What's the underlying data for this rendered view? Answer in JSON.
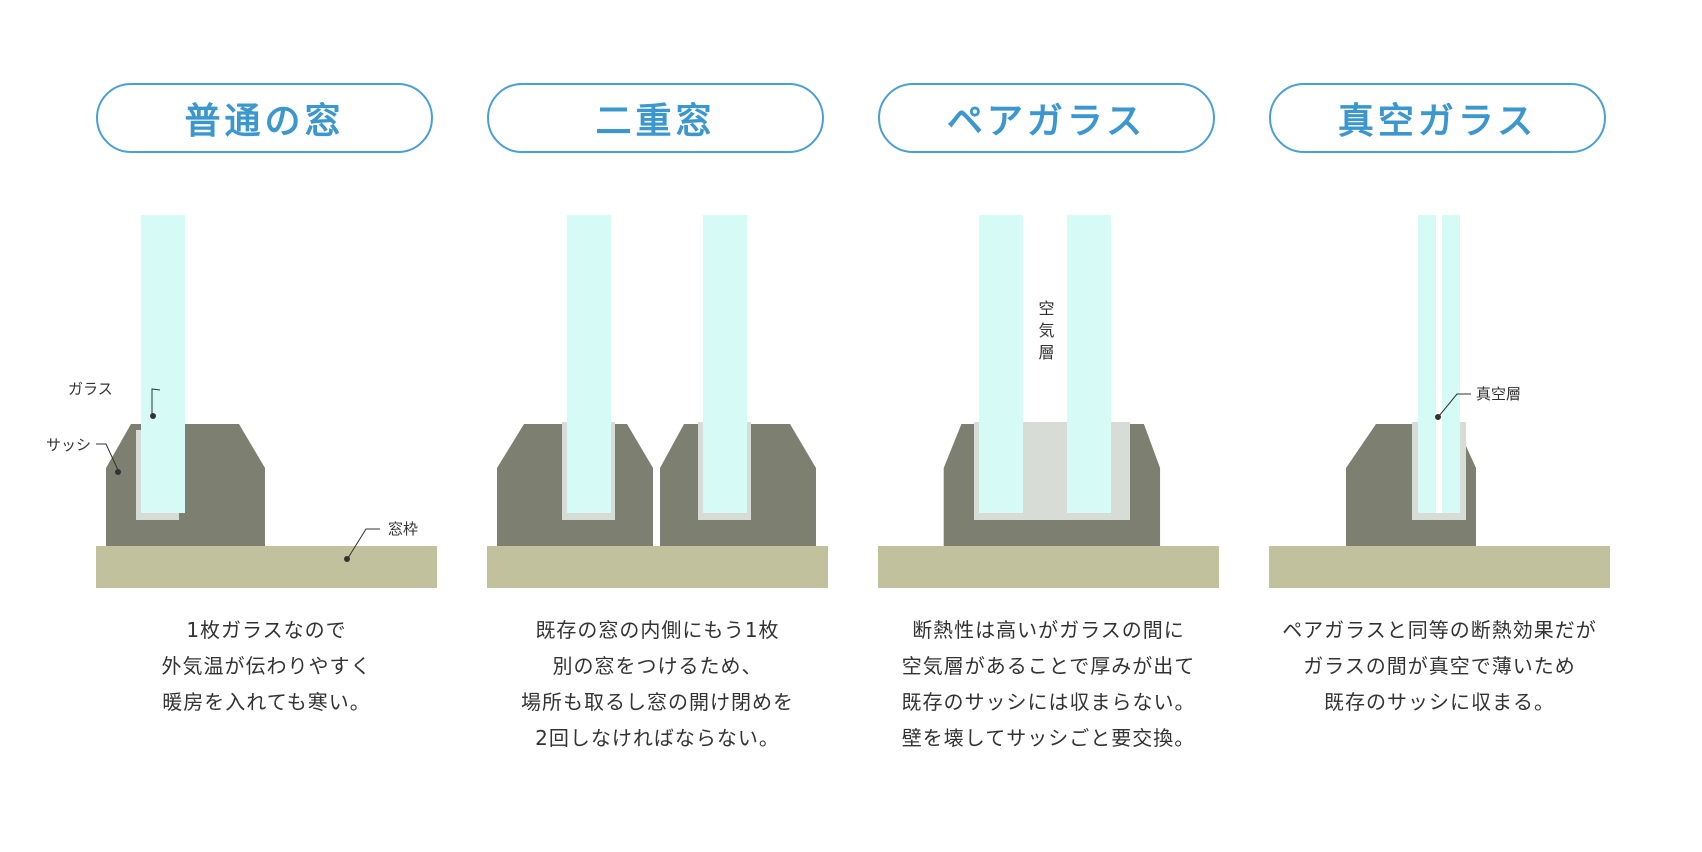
{
  "panels": [
    {
      "title": "普通の窓",
      "labels": {
        "glass": "ガラス",
        "sash": "サッシ",
        "frame": "窓枠"
      },
      "caption": [
        "1枚ガラスなので",
        "外気温が伝わりやすく",
        "暖房を入れても寒い。"
      ]
    },
    {
      "title": "二重窓",
      "caption": [
        "既存の窓の内側にもう1枚",
        "別の窓をつけるため、",
        "場所も取るし窓の開け閉めを",
        "2回しなければならない。"
      ]
    },
    {
      "title": "ペアガラス",
      "labels": {
        "air_layer": "空気層"
      },
      "caption": [
        "断熱性は高いがガラスの間に",
        "空気層があることで厚みが出て",
        "既存のサッシには収まらない。",
        "壁を壊してサッシごと要交換。"
      ]
    },
    {
      "title": "真空ガラス",
      "labels": {
        "vacuum_layer": "真空層"
      },
      "caption": [
        "ペアガラスと同等の断熱効果だが",
        "ガラスの間が真空で薄いため",
        "既存のサッシに収まる。"
      ]
    }
  ],
  "colors": {
    "accent": "#3d97cf",
    "glass": "#d6fbf6",
    "sash": "#7d7f70",
    "sash_inner": "#d7dcd6",
    "frame": "#c2c19d",
    "text": "#333333"
  }
}
